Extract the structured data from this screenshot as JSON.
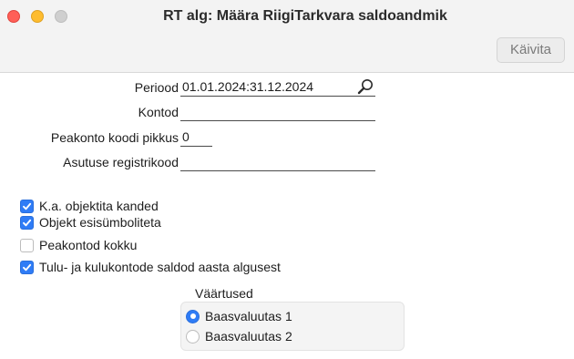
{
  "window": {
    "title": "RT alg: Määra RiigiTarkvara saldoandmik"
  },
  "toolbar": {
    "run_label": "Käivita"
  },
  "form": {
    "period": {
      "label": "Periood",
      "value": "01.01.2024:31.12.2024"
    },
    "accounts": {
      "label": "Kontod",
      "value": ""
    },
    "main_account_code_length": {
      "label": "Peakonto koodi pikkus",
      "value": "0"
    },
    "institution_reg_code": {
      "label": "Asutuse registrikood",
      "value": ""
    }
  },
  "options": [
    {
      "label": "K.a. objektita kanded",
      "checked": true
    },
    {
      "label": "Objekt esisümboliteta",
      "checked": true
    },
    {
      "label": "Peakontod kokku",
      "checked": false
    },
    {
      "label": "Tulu- ja kulukontode saldod aasta algusest",
      "checked": true
    }
  ],
  "values_group": {
    "title": "Väärtused",
    "options": [
      {
        "label": "Baasvaluutas 1",
        "selected": true
      },
      {
        "label": "Baasvaluutas 2",
        "selected": false
      }
    ]
  },
  "colors": {
    "accent": "#2f7cf6",
    "close": "#ff5f57",
    "minimize": "#febc2e",
    "maximize_disabled": "#cfcfcf"
  },
  "icons": {
    "paste_special": "magnifier-icon",
    "checkbox": "checkmark-icon"
  }
}
